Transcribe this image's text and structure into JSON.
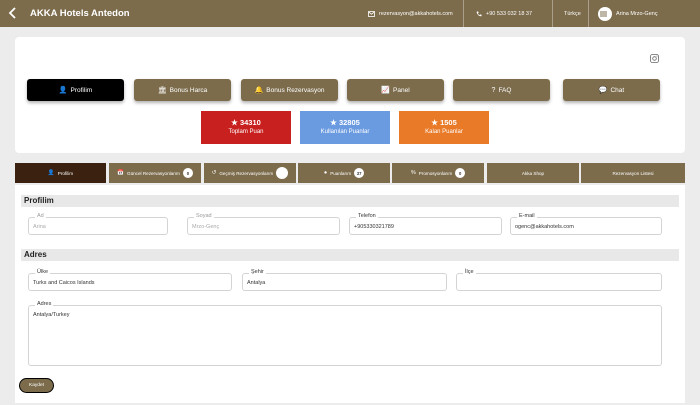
{
  "header": {
    "title": "AKKA Hotels Antedon",
    "email": "rezervasyon@akkahotels.com",
    "phone": "+90 533 032 18 37",
    "language": "Türkçe",
    "user": "Arina Mrzo-Genç"
  },
  "actions": [
    {
      "label": "Profilim",
      "icon": "user-icon"
    },
    {
      "label": "Bonus Harca",
      "icon": "hotel-icon"
    },
    {
      "label": "Bonus Rezervasyon",
      "icon": "bell-icon"
    },
    {
      "label": "Panel",
      "icon": "chart-icon"
    },
    {
      "label": "FAQ",
      "icon": "question-icon"
    },
    {
      "label": "Chat",
      "icon": "chat-icon"
    }
  ],
  "stats": [
    {
      "value": "34310",
      "label": "Toplam Puan",
      "color": "#c8201e"
    },
    {
      "value": "32805",
      "label": "Kullanılan Puanlar",
      "color": "#6a9ae0"
    },
    {
      "value": "1505",
      "label": "Kalan Puanlar",
      "color": "#e87a28"
    }
  ],
  "tabs": [
    {
      "label": "Profilim",
      "badge": ""
    },
    {
      "label": "Güncel Rezervasyonlarım",
      "badge": "0"
    },
    {
      "label": "Geçmiş Rezervasyonlarım",
      "badge": ""
    },
    {
      "label": "Puanlarım",
      "badge": "37"
    },
    {
      "label": "Promosyonlarım",
      "badge": "0"
    },
    {
      "label": "Akka Shop",
      "badge": ""
    },
    {
      "label": "Rezervasyon Listesi",
      "badge": ""
    }
  ],
  "profile": {
    "section_title": "Profilim",
    "first_name_label": "Ad",
    "first_name": "Arina",
    "last_name_label": "Soyad",
    "last_name": "Mrzo-Genç",
    "phone_label": "Telefon",
    "phone": "+905330321789",
    "email_label": "E-mail",
    "email": "ogenc@akkahotels.com"
  },
  "address": {
    "section_title": "Adres",
    "country_label": "Ülke",
    "country": "Turks and Caicos Islands",
    "city_label": "Şehir",
    "city": "Antalya",
    "district_label": "İlçe",
    "district": "",
    "address_label": "Adres",
    "address": "Antalya/Turkey"
  },
  "save_label": "Kaydet",
  "colors": {
    "brand": "#7c6c4c",
    "active_button": "#000000",
    "active_tab": "#3b2210"
  }
}
